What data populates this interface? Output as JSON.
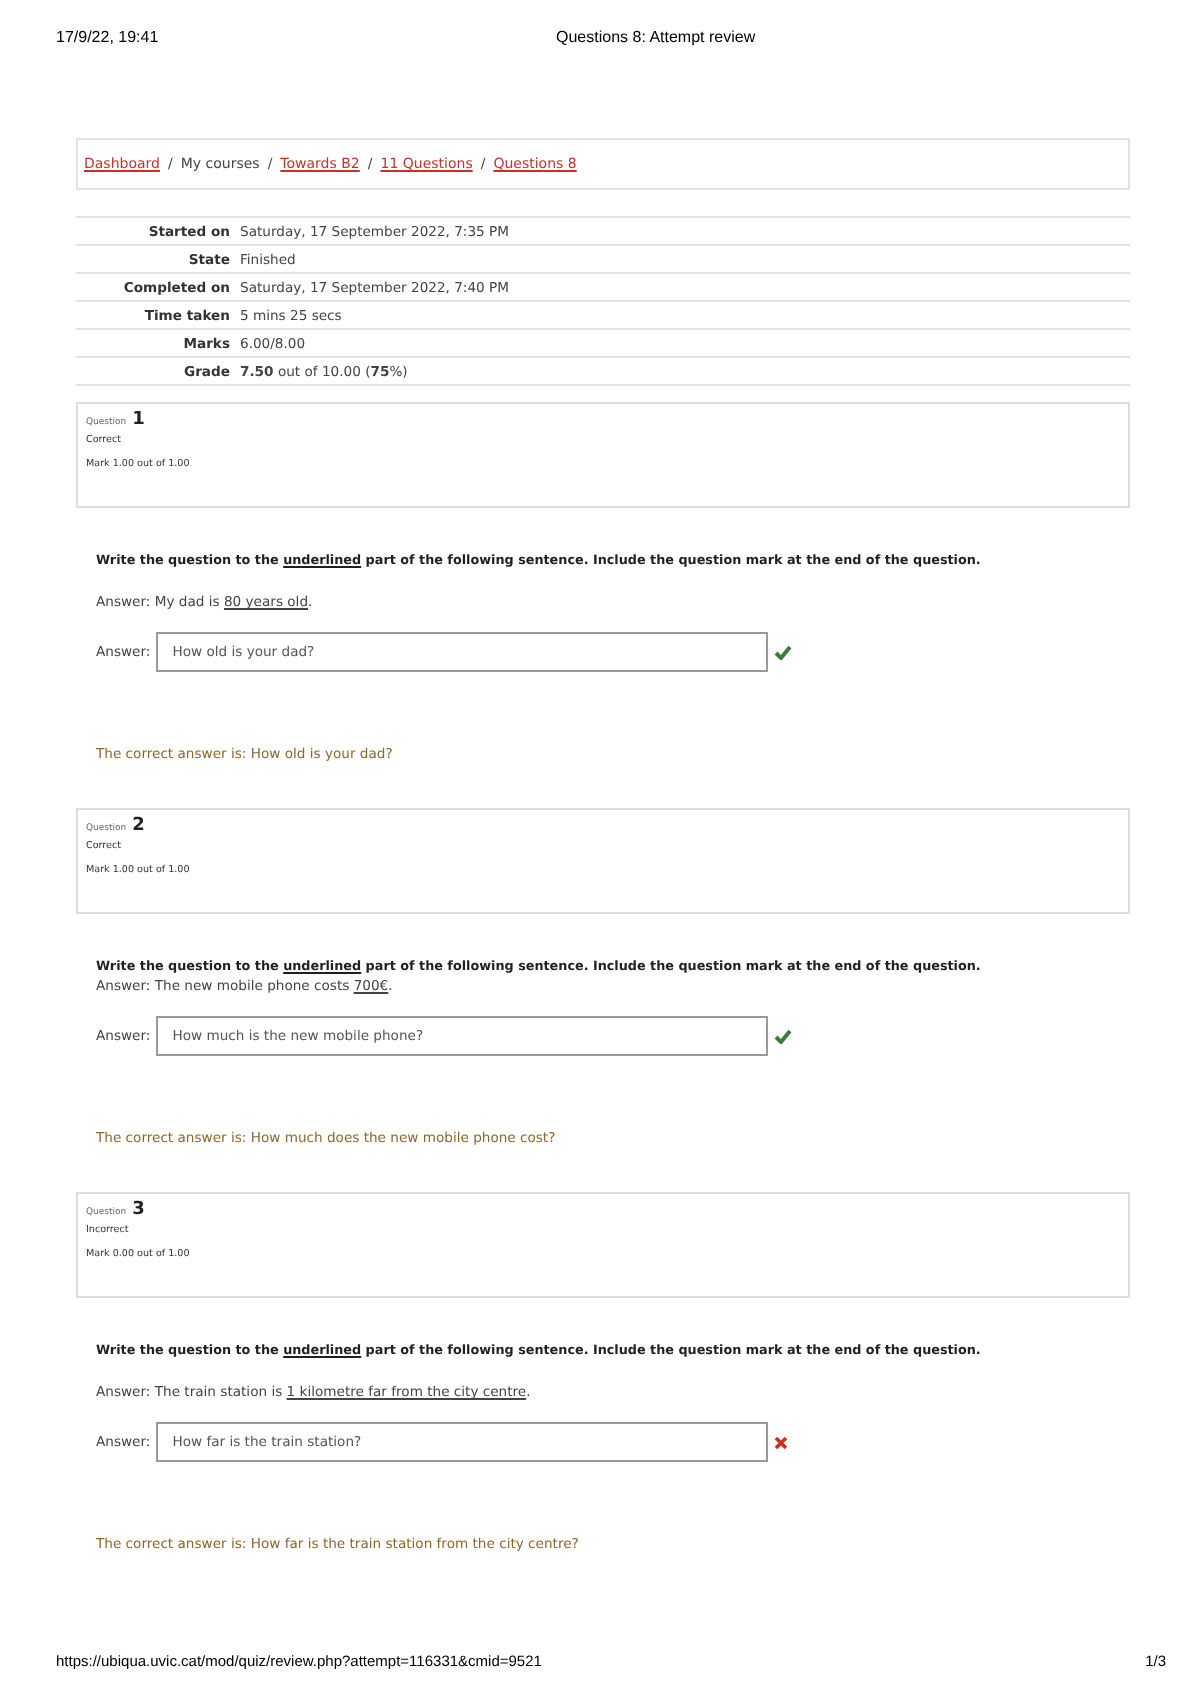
{
  "print_header": {
    "date": "17/9/22, 19:41",
    "title": "Questions 8: Attempt review"
  },
  "breadcrumb": [
    {
      "label": "Dashboard",
      "link": true
    },
    {
      "label": "My courses",
      "link": false
    },
    {
      "label": "Towards B2",
      "link": true
    },
    {
      "label": "11 Questions",
      "link": true
    },
    {
      "label": "Questions 8",
      "link": true
    }
  ],
  "breadcrumb_separator": "/",
  "summary": [
    {
      "label": "Started on",
      "value": "Saturday, 17 September 2022, 7:35 PM"
    },
    {
      "label": "State",
      "value": "Finished"
    },
    {
      "label": "Completed on",
      "value": "Saturday, 17 September 2022, 7:40 PM"
    },
    {
      "label": "Time taken",
      "value": "5 mins 25 secs"
    },
    {
      "label": "Marks",
      "value": "6.00/8.00"
    },
    {
      "label": "Grade",
      "value": "**7.50** out of 10.00 (**75**%)"
    }
  ],
  "questions": [
    {
      "label": "Question",
      "number": "1",
      "state": "Correct",
      "mark": "Mark 1.00 out of 1.00",
      "instruction": [
        {
          "text": "Write the question to the ",
          "underlined": false
        },
        {
          "text": "underlined",
          "underlined": true
        },
        {
          "text": " part of the following sentence.  Include the question mark at the end of the question.",
          "underlined": false
        }
      ],
      "sentence": [
        {
          "text": "Answer: My dad is ",
          "underlined": false
        },
        {
          "text": "80 years old",
          "underlined": true
        },
        {
          "text": ".",
          "underlined": false
        }
      ],
      "answer_label": "Answer:",
      "answer": "How old is your dad?",
      "correct": true,
      "correct_answer": "The correct answer is: How old is your dad?"
    },
    {
      "label": "Question",
      "number": "2",
      "state": "Correct",
      "mark": "Mark 1.00 out of 1.00",
      "instruction": [
        {
          "text": "Write the question to the ",
          "underlined": false
        },
        {
          "text": "underlined",
          "underlined": true
        },
        {
          "text": " part of the following sentence.  Include the question mark at the end of the question.",
          "underlined": false
        }
      ],
      "sentence": [
        {
          "text": "Answer: The new mobile phone costs ",
          "underlined": false
        },
        {
          "text": "700€",
          "underlined": true
        },
        {
          "text": ".",
          "underlined": false
        }
      ],
      "answer_label": "Answer:",
      "answer": "How much is the new mobile phone?",
      "correct": true,
      "correct_answer": "The correct answer is: How much does the new mobile phone cost?"
    },
    {
      "label": "Question",
      "number": "3",
      "state": "Incorrect",
      "mark": "Mark 0.00 out of 1.00",
      "instruction": [
        {
          "text": "Write the question to the ",
          "underlined": false
        },
        {
          "text": "underlined",
          "underlined": true
        },
        {
          "text": " part of the following sentence.  Include the question mark at the end of the question.",
          "underlined": false
        }
      ],
      "sentence": [
        {
          "text": "Answer: The train station is ",
          "underlined": false
        },
        {
          "text": "1 kilometre far from the city centre",
          "underlined": true
        },
        {
          "text": ".",
          "underlined": false
        }
      ],
      "answer_label": "Answer:",
      "answer": "How far is the train station?",
      "correct": false,
      "correct_answer": "The correct answer is: How far is the train station from the city centre?"
    }
  ],
  "print_footer": {
    "url": "https://ubiqua.uvic.cat/mod/quiz/review.php?attempt=116331&cmid=9521",
    "page": "1/3"
  }
}
